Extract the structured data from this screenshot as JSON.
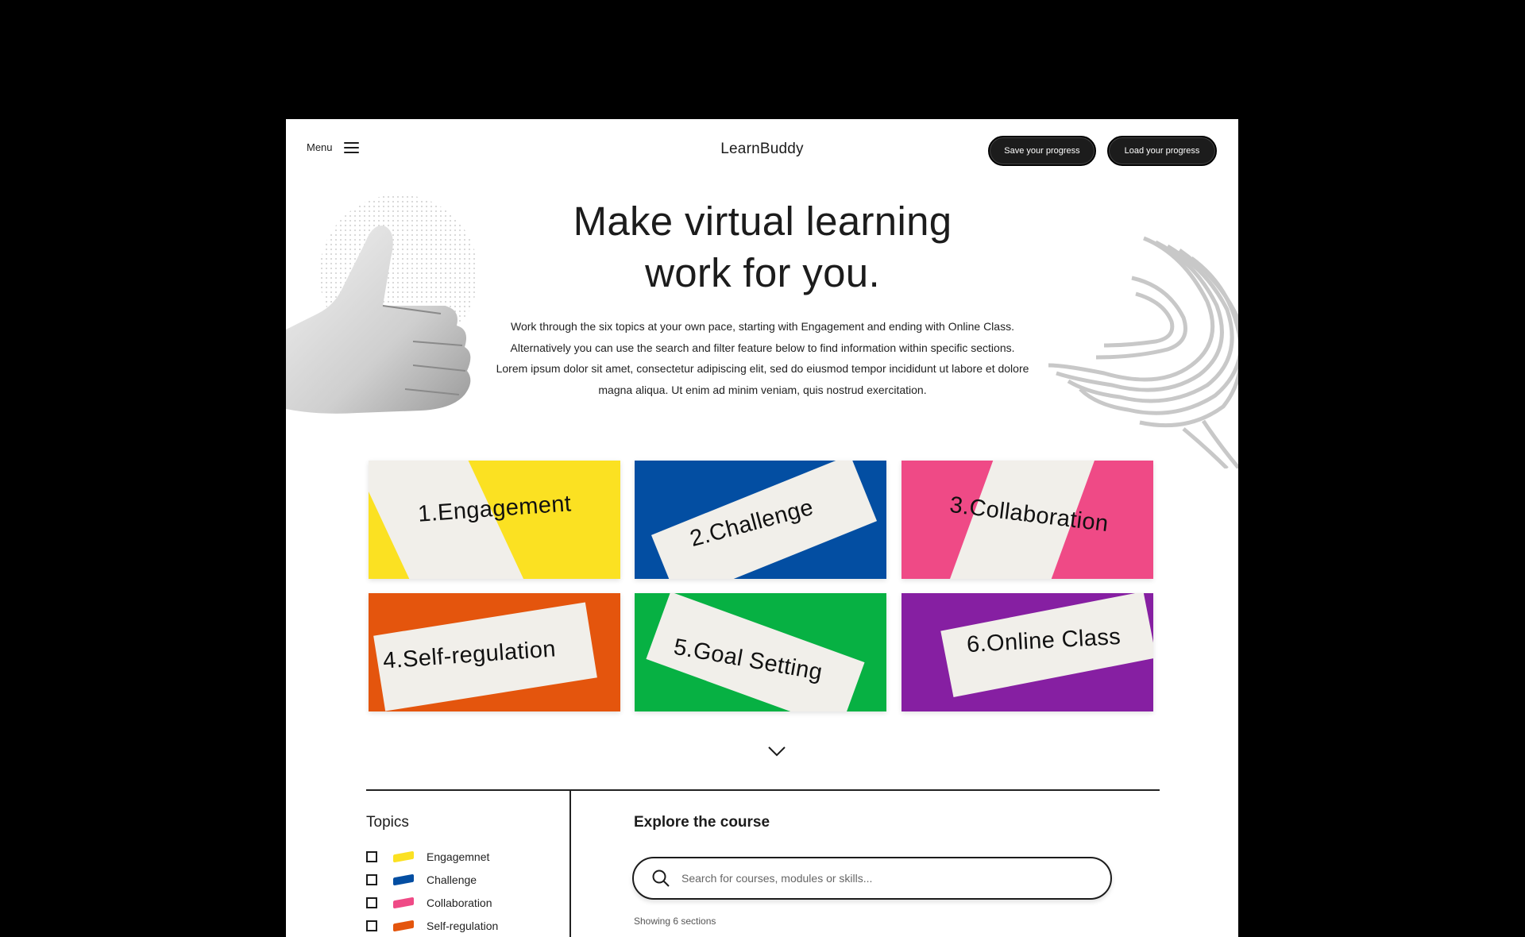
{
  "header": {
    "menu_label": "Menu",
    "brand": "LearnBuddy",
    "save_label": "Save your progress",
    "load_label": "Load your progress"
  },
  "hero": {
    "title_line1": "Make virtual learning",
    "title_line2": "work for you.",
    "description": "Work through the six topics at your own pace, starting with Engagement and ending with Online Class. Alternatively you can use the search and filter feature below to find information within specific sections. Lorem ipsum dolor sit amet, consectetur adipiscing elit, sed do eiusmod tempor incididunt ut labore et dolore magna aliqua. Ut enim ad minim veniam, quis nostrud exercitation."
  },
  "cards": [
    {
      "label": "1.Engagement",
      "color": "#fbe122"
    },
    {
      "label": "2.Challenge",
      "color": "#034ea2"
    },
    {
      "label": "3.Collaboration",
      "color": "#ef4a86"
    },
    {
      "label": "4.Self-regulation",
      "color": "#e4550d"
    },
    {
      "label": "5.Goal Setting",
      "color": "#07b143"
    },
    {
      "label": "6.Online Class",
      "color": "#861fa2"
    }
  ],
  "topics": {
    "title": "Topics",
    "items": [
      {
        "label": "Engagemnet",
        "color": "#fbe122"
      },
      {
        "label": "Challenge",
        "color": "#034ea2"
      },
      {
        "label": "Collaboration",
        "color": "#ef4a86"
      },
      {
        "label": "Self-regulation",
        "color": "#e4550d"
      }
    ]
  },
  "explore": {
    "title": "Explore the course",
    "search_placeholder": "Search for courses, modules or skills...",
    "showing": "Showing 6 sections"
  }
}
